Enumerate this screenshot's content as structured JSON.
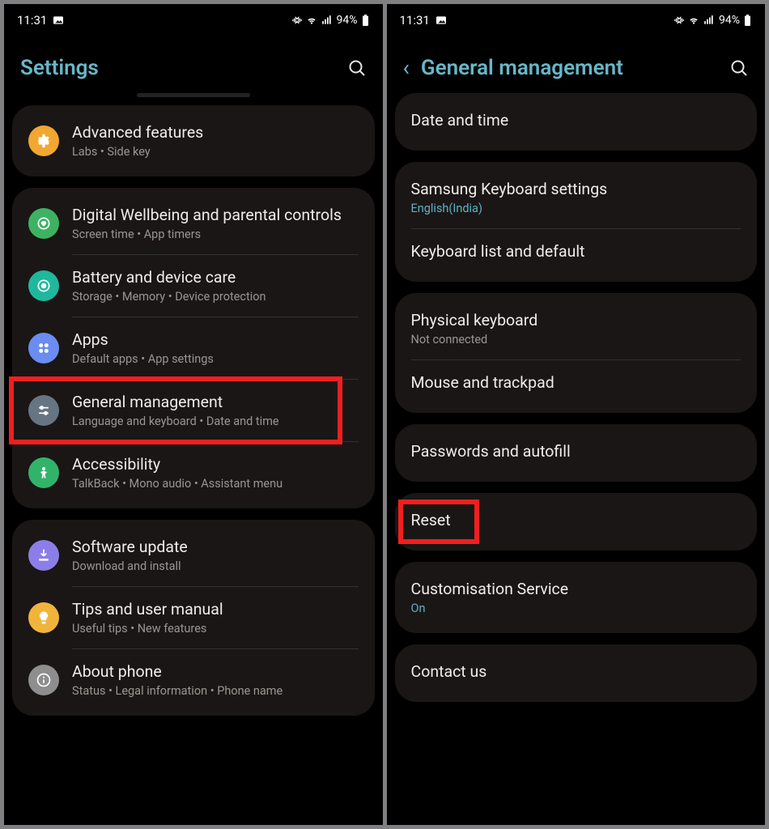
{
  "status": {
    "time": "11:31",
    "battery": "94%"
  },
  "left": {
    "title": "Settings",
    "groups": [
      {
        "items": [
          {
            "key": "advanced",
            "icon": "gear",
            "bg": "bg-orange",
            "title": "Advanced features",
            "sub": "Labs  •  Side key"
          }
        ]
      },
      {
        "items": [
          {
            "key": "wellbeing",
            "icon": "heart",
            "bg": "bg-green",
            "title": "Digital Wellbeing and parental controls",
            "sub": "Screen time  •  App timers"
          },
          {
            "key": "battery",
            "icon": "care",
            "bg": "bg-teal",
            "title": "Battery and device care",
            "sub": "Storage  •  Memory  •  Device protection"
          },
          {
            "key": "apps",
            "icon": "apps",
            "bg": "bg-blue",
            "title": "Apps",
            "sub": "Default apps  •  App settings"
          },
          {
            "key": "general",
            "icon": "sliders",
            "bg": "bg-slate",
            "title": "General management",
            "sub": "Language and keyboard  •  Date and time",
            "highlighted": true
          },
          {
            "key": "accessibility",
            "icon": "person",
            "bg": "bg-green2",
            "title": "Accessibility",
            "sub": "TalkBack  •  Mono audio  •  Assistant menu"
          }
        ]
      },
      {
        "items": [
          {
            "key": "update",
            "icon": "download",
            "bg": "bg-purple",
            "title": "Software update",
            "sub": "Download and install"
          },
          {
            "key": "tips",
            "icon": "bulb",
            "bg": "bg-amber",
            "title": "Tips and user manual",
            "sub": "Useful tips  •  New features"
          },
          {
            "key": "about",
            "icon": "info",
            "bg": "bg-grey",
            "title": "About phone",
            "sub": "Status  •  Legal information  •  Phone name"
          }
        ]
      }
    ]
  },
  "right": {
    "title": "General management",
    "groups": [
      {
        "items": [
          {
            "key": "date",
            "title": "Date and time"
          }
        ]
      },
      {
        "items": [
          {
            "key": "kbd",
            "title": "Samsung Keyboard settings",
            "sub": "English(India)",
            "accent": true
          },
          {
            "key": "kbdlist",
            "title": "Keyboard list and default"
          }
        ]
      },
      {
        "items": [
          {
            "key": "phys",
            "title": "Physical keyboard",
            "sub": "Not connected"
          },
          {
            "key": "mouse",
            "title": "Mouse and trackpad"
          }
        ]
      },
      {
        "items": [
          {
            "key": "pwd",
            "title": "Passwords and autofill"
          }
        ]
      },
      {
        "items": [
          {
            "key": "reset",
            "title": "Reset",
            "highlighted": true
          }
        ]
      },
      {
        "items": [
          {
            "key": "custom",
            "title": "Customisation Service",
            "sub": "On",
            "accent": true
          }
        ]
      },
      {
        "items": [
          {
            "key": "contact",
            "title": "Contact us"
          }
        ]
      }
    ]
  }
}
